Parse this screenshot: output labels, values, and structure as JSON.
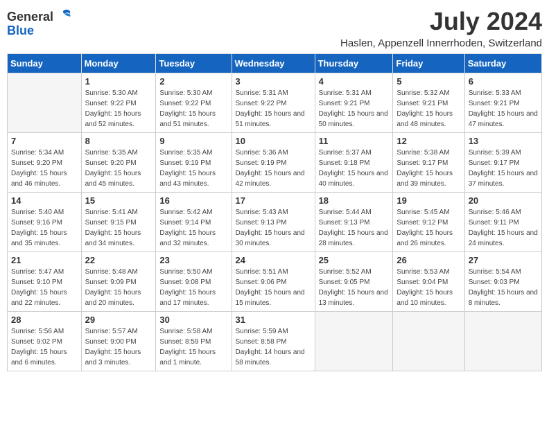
{
  "logo": {
    "general": "General",
    "blue": "Blue"
  },
  "title": "July 2024",
  "subtitle": "Haslen, Appenzell Innerrhoden, Switzerland",
  "headers": [
    "Sunday",
    "Monday",
    "Tuesday",
    "Wednesday",
    "Thursday",
    "Friday",
    "Saturday"
  ],
  "weeks": [
    [
      {
        "day": "",
        "empty": true
      },
      {
        "day": "1",
        "sunrise": "5:30 AM",
        "sunset": "9:22 PM",
        "daylight": "15 hours and 52 minutes."
      },
      {
        "day": "2",
        "sunrise": "5:30 AM",
        "sunset": "9:22 PM",
        "daylight": "15 hours and 51 minutes."
      },
      {
        "day": "3",
        "sunrise": "5:31 AM",
        "sunset": "9:22 PM",
        "daylight": "15 hours and 51 minutes."
      },
      {
        "day": "4",
        "sunrise": "5:31 AM",
        "sunset": "9:21 PM",
        "daylight": "15 hours and 50 minutes."
      },
      {
        "day": "5",
        "sunrise": "5:32 AM",
        "sunset": "9:21 PM",
        "daylight": "15 hours and 48 minutes."
      },
      {
        "day": "6",
        "sunrise": "5:33 AM",
        "sunset": "9:21 PM",
        "daylight": "15 hours and 47 minutes."
      }
    ],
    [
      {
        "day": "7",
        "sunrise": "5:34 AM",
        "sunset": "9:20 PM",
        "daylight": "15 hours and 46 minutes."
      },
      {
        "day": "8",
        "sunrise": "5:35 AM",
        "sunset": "9:20 PM",
        "daylight": "15 hours and 45 minutes."
      },
      {
        "day": "9",
        "sunrise": "5:35 AM",
        "sunset": "9:19 PM",
        "daylight": "15 hours and 43 minutes."
      },
      {
        "day": "10",
        "sunrise": "5:36 AM",
        "sunset": "9:19 PM",
        "daylight": "15 hours and 42 minutes."
      },
      {
        "day": "11",
        "sunrise": "5:37 AM",
        "sunset": "9:18 PM",
        "daylight": "15 hours and 40 minutes."
      },
      {
        "day": "12",
        "sunrise": "5:38 AM",
        "sunset": "9:17 PM",
        "daylight": "15 hours and 39 minutes."
      },
      {
        "day": "13",
        "sunrise": "5:39 AM",
        "sunset": "9:17 PM",
        "daylight": "15 hours and 37 minutes."
      }
    ],
    [
      {
        "day": "14",
        "sunrise": "5:40 AM",
        "sunset": "9:16 PM",
        "daylight": "15 hours and 35 minutes."
      },
      {
        "day": "15",
        "sunrise": "5:41 AM",
        "sunset": "9:15 PM",
        "daylight": "15 hours and 34 minutes."
      },
      {
        "day": "16",
        "sunrise": "5:42 AM",
        "sunset": "9:14 PM",
        "daylight": "15 hours and 32 minutes."
      },
      {
        "day": "17",
        "sunrise": "5:43 AM",
        "sunset": "9:13 PM",
        "daylight": "15 hours and 30 minutes."
      },
      {
        "day": "18",
        "sunrise": "5:44 AM",
        "sunset": "9:13 PM",
        "daylight": "15 hours and 28 minutes."
      },
      {
        "day": "19",
        "sunrise": "5:45 AM",
        "sunset": "9:12 PM",
        "daylight": "15 hours and 26 minutes."
      },
      {
        "day": "20",
        "sunrise": "5:46 AM",
        "sunset": "9:11 PM",
        "daylight": "15 hours and 24 minutes."
      }
    ],
    [
      {
        "day": "21",
        "sunrise": "5:47 AM",
        "sunset": "9:10 PM",
        "daylight": "15 hours and 22 minutes."
      },
      {
        "day": "22",
        "sunrise": "5:48 AM",
        "sunset": "9:09 PM",
        "daylight": "15 hours and 20 minutes."
      },
      {
        "day": "23",
        "sunrise": "5:50 AM",
        "sunset": "9:08 PM",
        "daylight": "15 hours and 17 minutes."
      },
      {
        "day": "24",
        "sunrise": "5:51 AM",
        "sunset": "9:06 PM",
        "daylight": "15 hours and 15 minutes."
      },
      {
        "day": "25",
        "sunrise": "5:52 AM",
        "sunset": "9:05 PM",
        "daylight": "15 hours and 13 minutes."
      },
      {
        "day": "26",
        "sunrise": "5:53 AM",
        "sunset": "9:04 PM",
        "daylight": "15 hours and 10 minutes."
      },
      {
        "day": "27",
        "sunrise": "5:54 AM",
        "sunset": "9:03 PM",
        "daylight": "15 hours and 8 minutes."
      }
    ],
    [
      {
        "day": "28",
        "sunrise": "5:56 AM",
        "sunset": "9:02 PM",
        "daylight": "15 hours and 6 minutes."
      },
      {
        "day": "29",
        "sunrise": "5:57 AM",
        "sunset": "9:00 PM",
        "daylight": "15 hours and 3 minutes."
      },
      {
        "day": "30",
        "sunrise": "5:58 AM",
        "sunset": "8:59 PM",
        "daylight": "15 hours and 1 minute."
      },
      {
        "day": "31",
        "sunrise": "5:59 AM",
        "sunset": "8:58 PM",
        "daylight": "14 hours and 58 minutes."
      },
      {
        "day": "",
        "empty": true
      },
      {
        "day": "",
        "empty": true
      },
      {
        "day": "",
        "empty": true
      }
    ]
  ],
  "labels": {
    "sunrise": "Sunrise:",
    "sunset": "Sunset:",
    "daylight": "Daylight:"
  }
}
